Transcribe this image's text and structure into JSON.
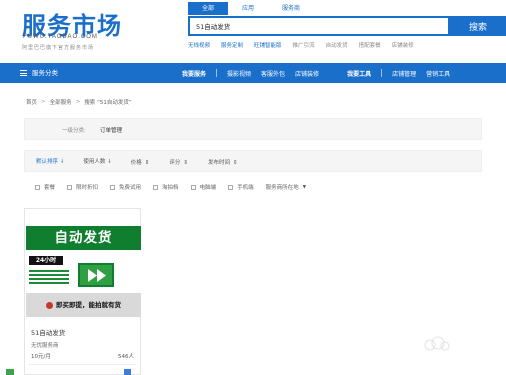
{
  "logo": {
    "main": "服务市场",
    "sub": "FUWU.TAOBAO.COM",
    "slogan": "阿里巴巴旗下官方服务市场"
  },
  "search": {
    "tabs": [
      "全部",
      "应用",
      "服务商"
    ],
    "active_tab": "全部",
    "value": "51自动发货",
    "button_label": "搜索",
    "hot_links": [
      "无线视频",
      "服务定制",
      "旺铺智能版",
      "推广引流",
      "自动发货",
      "搭配套餐",
      "店铺装修"
    ]
  },
  "nav": {
    "category_label": "服务分类",
    "items": [
      {
        "label": "我要服务",
        "bold": true
      },
      {
        "label": "摄影视频",
        "bold": false
      },
      {
        "label": "客服外包",
        "bold": false
      },
      {
        "label": "店铺装修",
        "bold": false
      },
      {
        "label": "我要工具",
        "bold": true
      },
      {
        "label": "店铺管理",
        "bold": false
      },
      {
        "label": "营销工具",
        "bold": false
      }
    ]
  },
  "breadcrumb": {
    "items": [
      "首页",
      "全部服务",
      "搜索 “51自动发货”"
    ],
    "separator": ">"
  },
  "filters": {
    "category_label": "一级分类:",
    "category_value": "订单管理",
    "sort_options": [
      {
        "label": "默认排序",
        "arrow": "down-filled"
      },
      {
        "label": "使用人数",
        "arrow": "down-filled"
      },
      {
        "label": "价格",
        "arrow": "updown"
      },
      {
        "label": "评分",
        "arrow": "updown"
      },
      {
        "label": "发布时间",
        "arrow": "updown"
      }
    ],
    "checkboxes": [
      "套餐",
      "限时折扣",
      "免费试用",
      "淘拍档",
      "电脑端",
      "手机端"
    ],
    "location_label": "服务商所在地"
  },
  "product": {
    "image_top_text": "自动发货",
    "image_badge_text": "24小时",
    "image_bottom_text": "即买即提，能拍就有货",
    "name": "51自动发货",
    "vendor": "无忧服务商",
    "price": "10元/月",
    "users": "546人"
  },
  "colors": {
    "brand_blue": "#1a6fcb",
    "product_green": "#0f7e2e"
  }
}
